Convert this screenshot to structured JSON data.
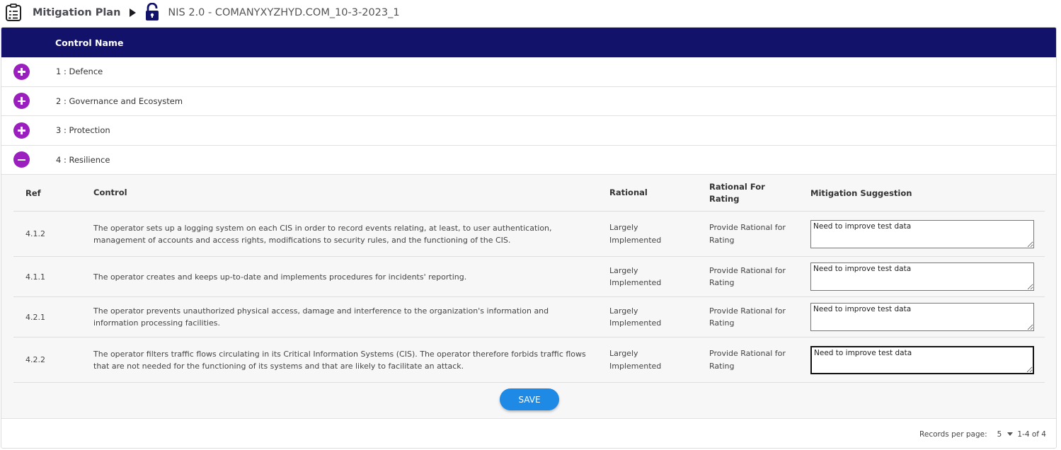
{
  "breadcrumb": {
    "section": "Mitigation Plan",
    "assessment": "NIS 2.0 - COMANYXYZHYD.COM_10-3-2023_1"
  },
  "table_header": {
    "control_name": "Control Name"
  },
  "groups": [
    {
      "label": "1 : Defence",
      "expanded": false
    },
    {
      "label": "2 : Governance and Ecosystem",
      "expanded": false
    },
    {
      "label": "3 : Protection",
      "expanded": false
    },
    {
      "label": "4 : Resilience",
      "expanded": true
    }
  ],
  "detail_columns": {
    "ref": "Ref",
    "control": "Control",
    "rational": "Rational",
    "rational_for_rating": "Rational For Rating",
    "mitigation": "Mitigation Suggestion"
  },
  "rows": [
    {
      "ref": "4.1.2",
      "control": "The operator sets up a logging system on each CIS in order to record events relating, at least, to user authentication, management of accounts and access rights, modifications to security rules, and the functioning of the CIS.",
      "rational": "Largely Implemented",
      "rational_for_rating": "Provide Rational for Rating",
      "mitigation": "Need to improve test data"
    },
    {
      "ref": "4.1.1",
      "control": "The operator creates and keeps up-to-date and implements procedures for incidents' reporting.",
      "rational": "Largely Implemented",
      "rational_for_rating": "Provide Rational for Rating",
      "mitigation": "Need to improve test data"
    },
    {
      "ref": "4.2.1",
      "control": "The operator prevents unauthorized physical access, damage and interference to the organization's information and information processing facilities.",
      "rational": "Largely Implemented",
      "rational_for_rating": "Provide Rational for Rating",
      "mitigation": "Need to improve test data"
    },
    {
      "ref": "4.2.2",
      "control": "The operator filters traffic flows circulating in its Critical Information Systems (CIS). The operator therefore forbids traffic flows that are not needed for the functioning of its systems and that are likely to facilitate an attack.",
      "rational": "Largely Implemented",
      "rational_for_rating": "Provide Rational for Rating",
      "mitigation": "Need to improve test data"
    }
  ],
  "save_label": "SAVE",
  "pagination": {
    "records_per_page_label": "Records per page:",
    "records_per_page_value": "5",
    "range": "1-4 of 4"
  },
  "colors": {
    "header_bg": "#13126b",
    "toggle": "#9a1fbe",
    "save_button": "#1e8ae5"
  }
}
